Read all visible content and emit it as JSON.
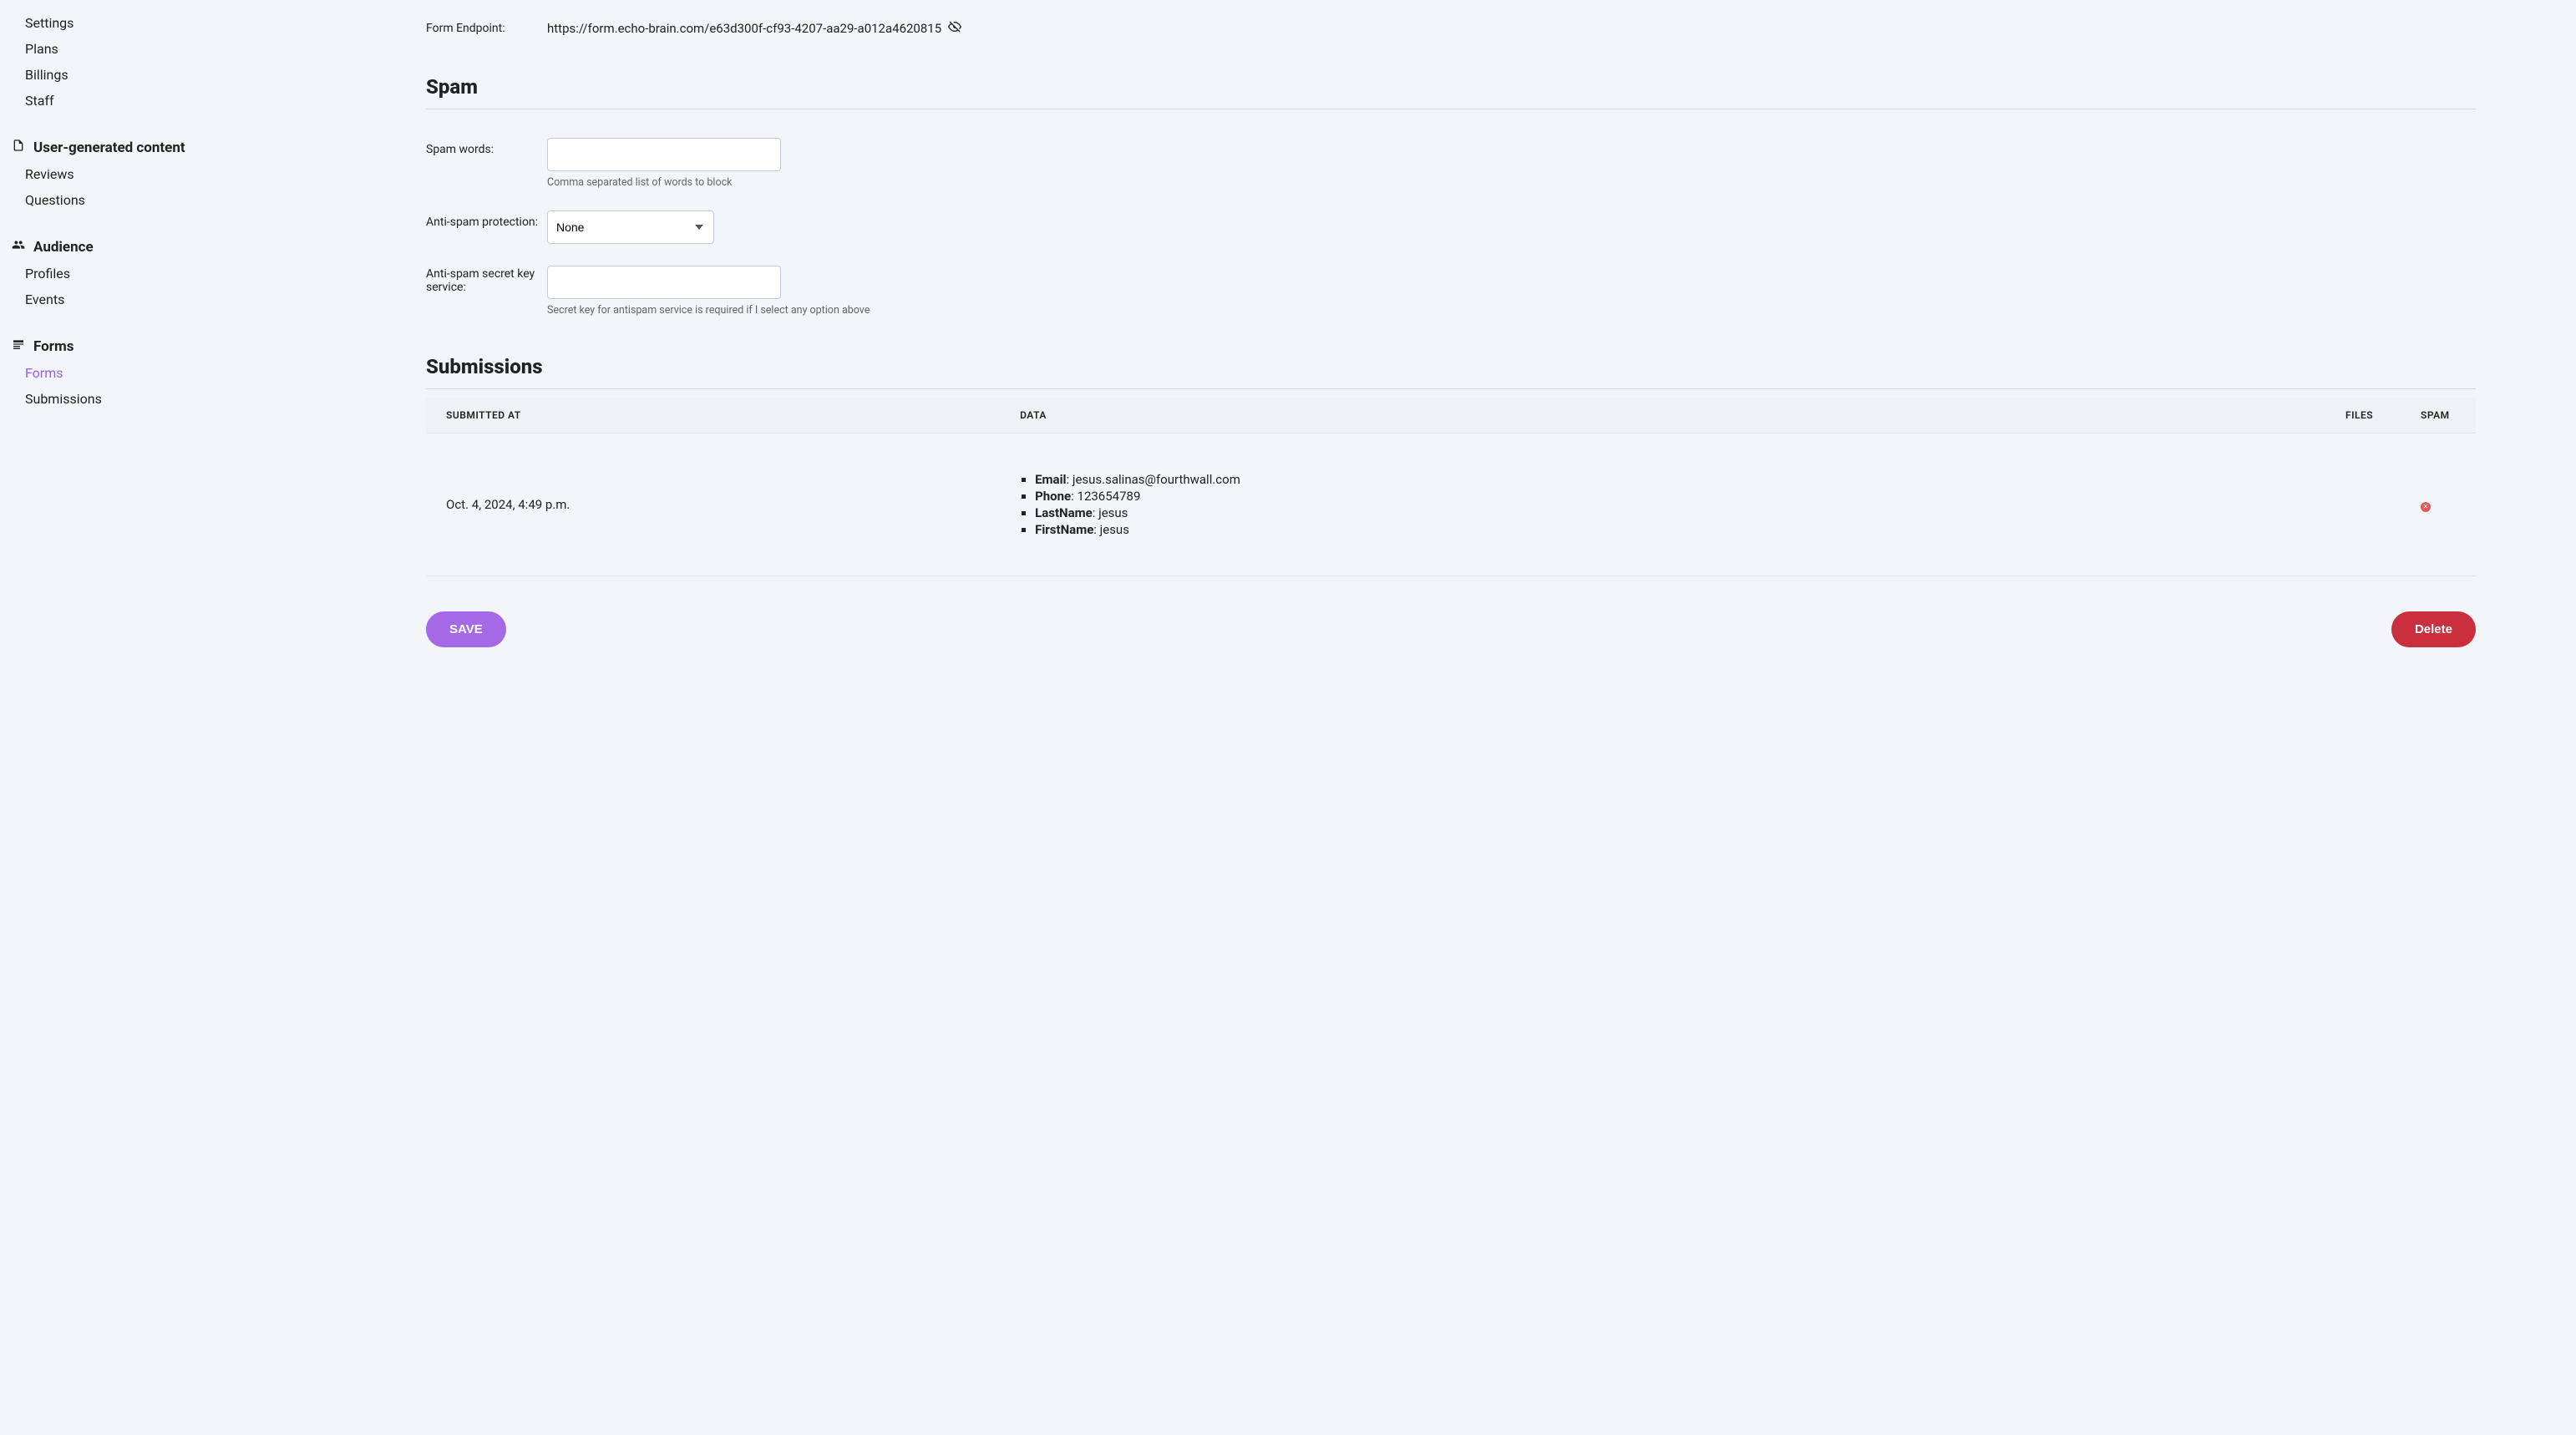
{
  "sidebar": {
    "top_items": [
      "Settings",
      "Plans",
      "Billings",
      "Staff"
    ],
    "groups": [
      {
        "title": "User-generated content",
        "icon": "document-icon",
        "items": [
          {
            "label": "Reviews",
            "active": false
          },
          {
            "label": "Questions",
            "active": false
          }
        ]
      },
      {
        "title": "Audience",
        "icon": "people-icon",
        "items": [
          {
            "label": "Profiles",
            "active": false
          },
          {
            "label": "Events",
            "active": false
          }
        ]
      },
      {
        "title": "Forms",
        "icon": "form-icon",
        "items": [
          {
            "label": "Forms",
            "active": true
          },
          {
            "label": "Submissions",
            "active": false
          }
        ]
      }
    ]
  },
  "form_endpoint": {
    "label": "Form Endpoint:",
    "value": "https://form.echo-brain.com/e63d300f-cf93-4207-aa29-a012a4620815"
  },
  "spam": {
    "section_title": "Spam",
    "spam_words": {
      "label": "Spam words:",
      "value": "",
      "help": "Comma separated list of words to block"
    },
    "anti_spam_protection": {
      "label": "Anti-spam protection:",
      "value": "None",
      "options": [
        "None"
      ]
    },
    "secret_key": {
      "label": "Anti-spam secret key service:",
      "value": "",
      "help": "Secret key for antispam service is required if I select any option above"
    }
  },
  "submissions": {
    "section_title": "Submissions",
    "columns": [
      "SUBMITTED AT",
      "DATA",
      "FILES",
      "SPAM"
    ],
    "rows": [
      {
        "submitted_at": "Oct. 4, 2024, 4:49 p.m.",
        "data": [
          {
            "k": "Email",
            "v": "jesus.salinas@fourthwall.com"
          },
          {
            "k": "Phone",
            "v": "123654789"
          },
          {
            "k": "LastName",
            "v": "jesus"
          },
          {
            "k": "FirstName",
            "v": "jesus"
          }
        ],
        "files": "",
        "spam": false
      }
    ]
  },
  "buttons": {
    "save": "SAVE",
    "delete": "Delete"
  }
}
